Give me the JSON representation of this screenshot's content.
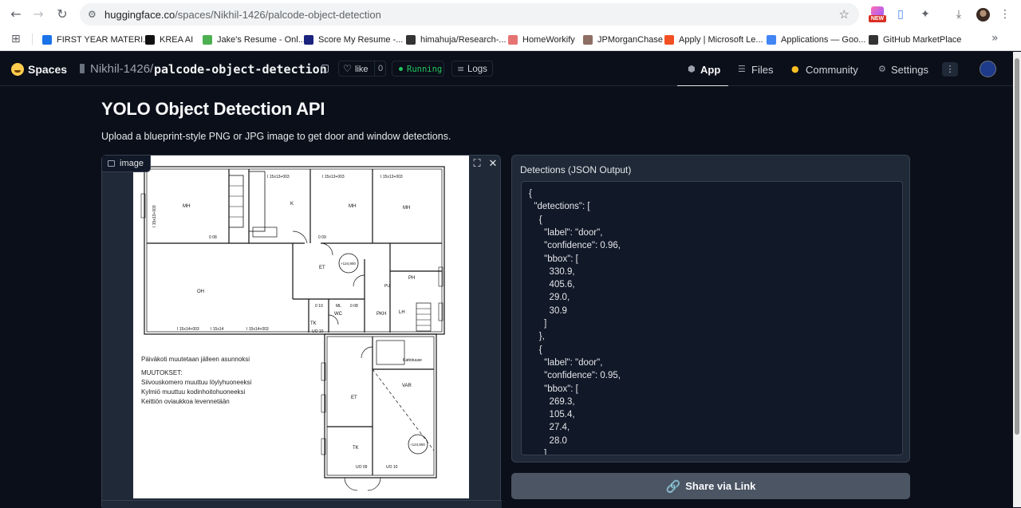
{
  "browser": {
    "url_host": "huggingface.co",
    "url_path": "/spaces/Nikhil-1426/palcode-object-detection",
    "new_badge": "NEW",
    "bookmarks": [
      {
        "label": "FIRST YEAR MATERI...",
        "color": "#1a73e8"
      },
      {
        "label": "KREA AI",
        "color": "#111111"
      },
      {
        "label": "Jake's Resume - Onl...",
        "color": "#4caf50"
      },
      {
        "label": "Score My Resume -...",
        "color": "#1a237e"
      },
      {
        "label": "himahuja/Research-...",
        "color": "#333333"
      },
      {
        "label": "HomeWorkify",
        "color": "#e57373"
      },
      {
        "label": "JPMorganChase",
        "color": "#8d6e63"
      },
      {
        "label": "Apply | Microsoft Le...",
        "color": "#f25022"
      },
      {
        "label": "Applications — Goo...",
        "color": "#4285f4"
      },
      {
        "label": "GitHub MarketPlace",
        "color": "#333333"
      }
    ]
  },
  "hf": {
    "brand": "Spaces",
    "owner": "Nikhil-1426/",
    "repo": "palcode-object-detection",
    "like_label": "like",
    "like_count": "0",
    "status": "Running",
    "logs_label": "Logs",
    "tabs": [
      {
        "label": "App",
        "icon": "⬢"
      },
      {
        "label": "Files",
        "icon": "☰"
      },
      {
        "label": "Community",
        "icon": "●"
      },
      {
        "label": "Settings",
        "icon": "⚙"
      }
    ]
  },
  "app": {
    "title": "YOLO Object Detection API",
    "description": "Upload a blueprint-style PNG or JPG image to get door and window detections.",
    "image_label": "image",
    "blueprint": {
      "rooms": {
        "mh1": "MH",
        "k": "K",
        "mh2": "MH",
        "mh3": "MH",
        "et1": "ET",
        "oh": "OH",
        "ph": "PH",
        "pkh": "PKH",
        "tk1": "TK",
        "lh": "LH",
        "wc": "WC",
        "kattotuuse": "Kattotuuse",
        "et2": "ET",
        "var": "VAR",
        "tk2": "TK"
      },
      "dims": {
        "d1": "I 15x13+003",
        "d2": "I 15x13+003",
        "d3": "I 15x13+003",
        "d4": "I 15x14+003",
        "d5": "I 15x14",
        "d6": "I 15x14+003",
        "side": "I 15x13+003",
        "circle1": "+124,900",
        "circle2": "+124,900"
      },
      "doors": {
        "o1": "0 08",
        "o2": "0 09",
        "o3": "0 10",
        "o4": "0 08",
        "u1": "UO 10",
        "u2": "UO 09",
        "u3": "UO 10",
        "ml": "ML",
        "pu": "PU"
      },
      "notes": [
        "Päiväkoti muutetaan jälleen asunnoksi",
        "MUUTOKSET:",
        "Siivouskomero muuttuu löylyhuoneeksi",
        "Kylmiö muuttuu kodinhoitohuoneeksi",
        "Keittiön oviaukkoa levennetään"
      ]
    },
    "json_label": "Detections (JSON Output)",
    "json_lines": [
      "{",
      "  \"detections\": [",
      "    {",
      "      \"label\": \"door\",",
      "      \"confidence\": 0.96,",
      "      \"bbox\": [",
      "        330.9,",
      "        405.6,",
      "        29.0,",
      "        30.9",
      "      ]",
      "    },",
      "    {",
      "      \"label\": \"door\",",
      "      \"confidence\": 0.95,",
      "      \"bbox\": [",
      "        269.3,",
      "        105.4,",
      "        27.4,",
      "        28.0",
      "      ]"
    ],
    "share_label": "Share via Link"
  },
  "colors": {
    "bg": "#0b0f19",
    "panel": "#1f2937",
    "status_green": "#22c55e",
    "share_button": "#4b5563"
  }
}
